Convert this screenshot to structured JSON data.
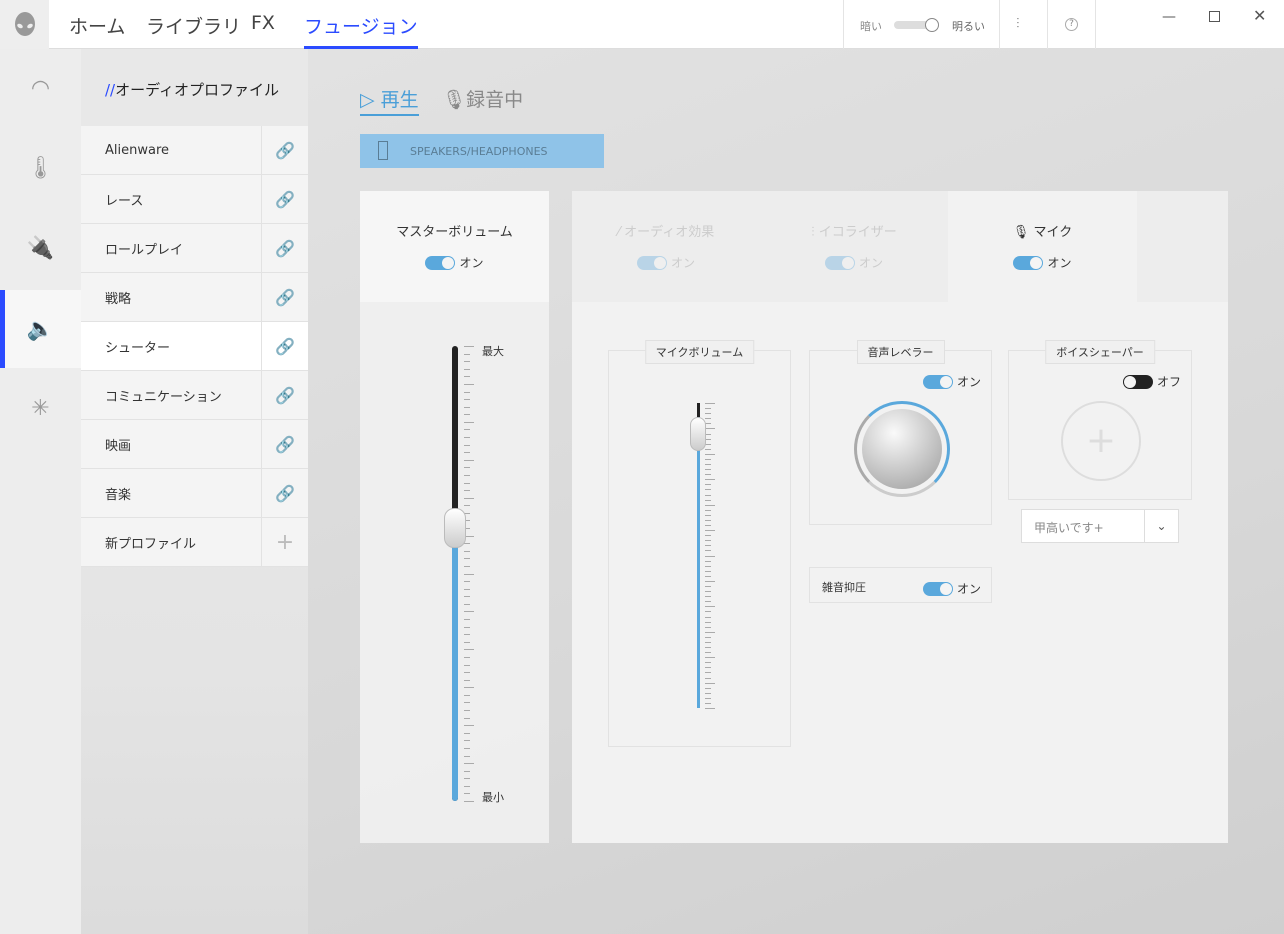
{
  "nav": {
    "tabs": [
      "ホーム",
      "ライブラリ",
      "FX",
      "フュージョン"
    ],
    "active": 3
  },
  "theme": {
    "dark_label": "暗い",
    "light_label": "明るい"
  },
  "sidebar": {
    "header_prefix": "//",
    "header": "オーディオプロファイル",
    "profiles": [
      {
        "name": "Alienware"
      },
      {
        "name": "レース"
      },
      {
        "name": "ロールプレイ"
      },
      {
        "name": "戦略"
      },
      {
        "name": "シューター"
      },
      {
        "name": "コミュニケーション"
      },
      {
        "name": "映画"
      },
      {
        "name": "音楽"
      }
    ],
    "active_profile": 4,
    "new_profile": "新プロファイル"
  },
  "main": {
    "playback_tab": "再生",
    "recording_tab": "録音中",
    "device": "SPEAKERS/HEADPHONES",
    "master": {
      "title": "マスターボリューム",
      "toggle": "オン",
      "max": "最大",
      "min": "最小",
      "level": 0.6
    },
    "tabs": [
      {
        "label": "オーディオ効果",
        "toggle": "オン"
      },
      {
        "label": "イコライザー",
        "toggle": "オン"
      },
      {
        "label": "マイク",
        "toggle": "オン"
      }
    ],
    "mic_volume": {
      "title": "マイクボリューム",
      "level": 0.91
    },
    "leveler": {
      "title": "音声レベラー",
      "toggle": "オン"
    },
    "noise": {
      "title": "雑音抑圧",
      "toggle": "オン"
    },
    "shaper": {
      "title": "ボイスシェーパー",
      "toggle": "オフ",
      "preset": "甲高いです+"
    }
  },
  "colors": {
    "accent": "#2b4bff",
    "toggle": "#5aa8dc"
  }
}
